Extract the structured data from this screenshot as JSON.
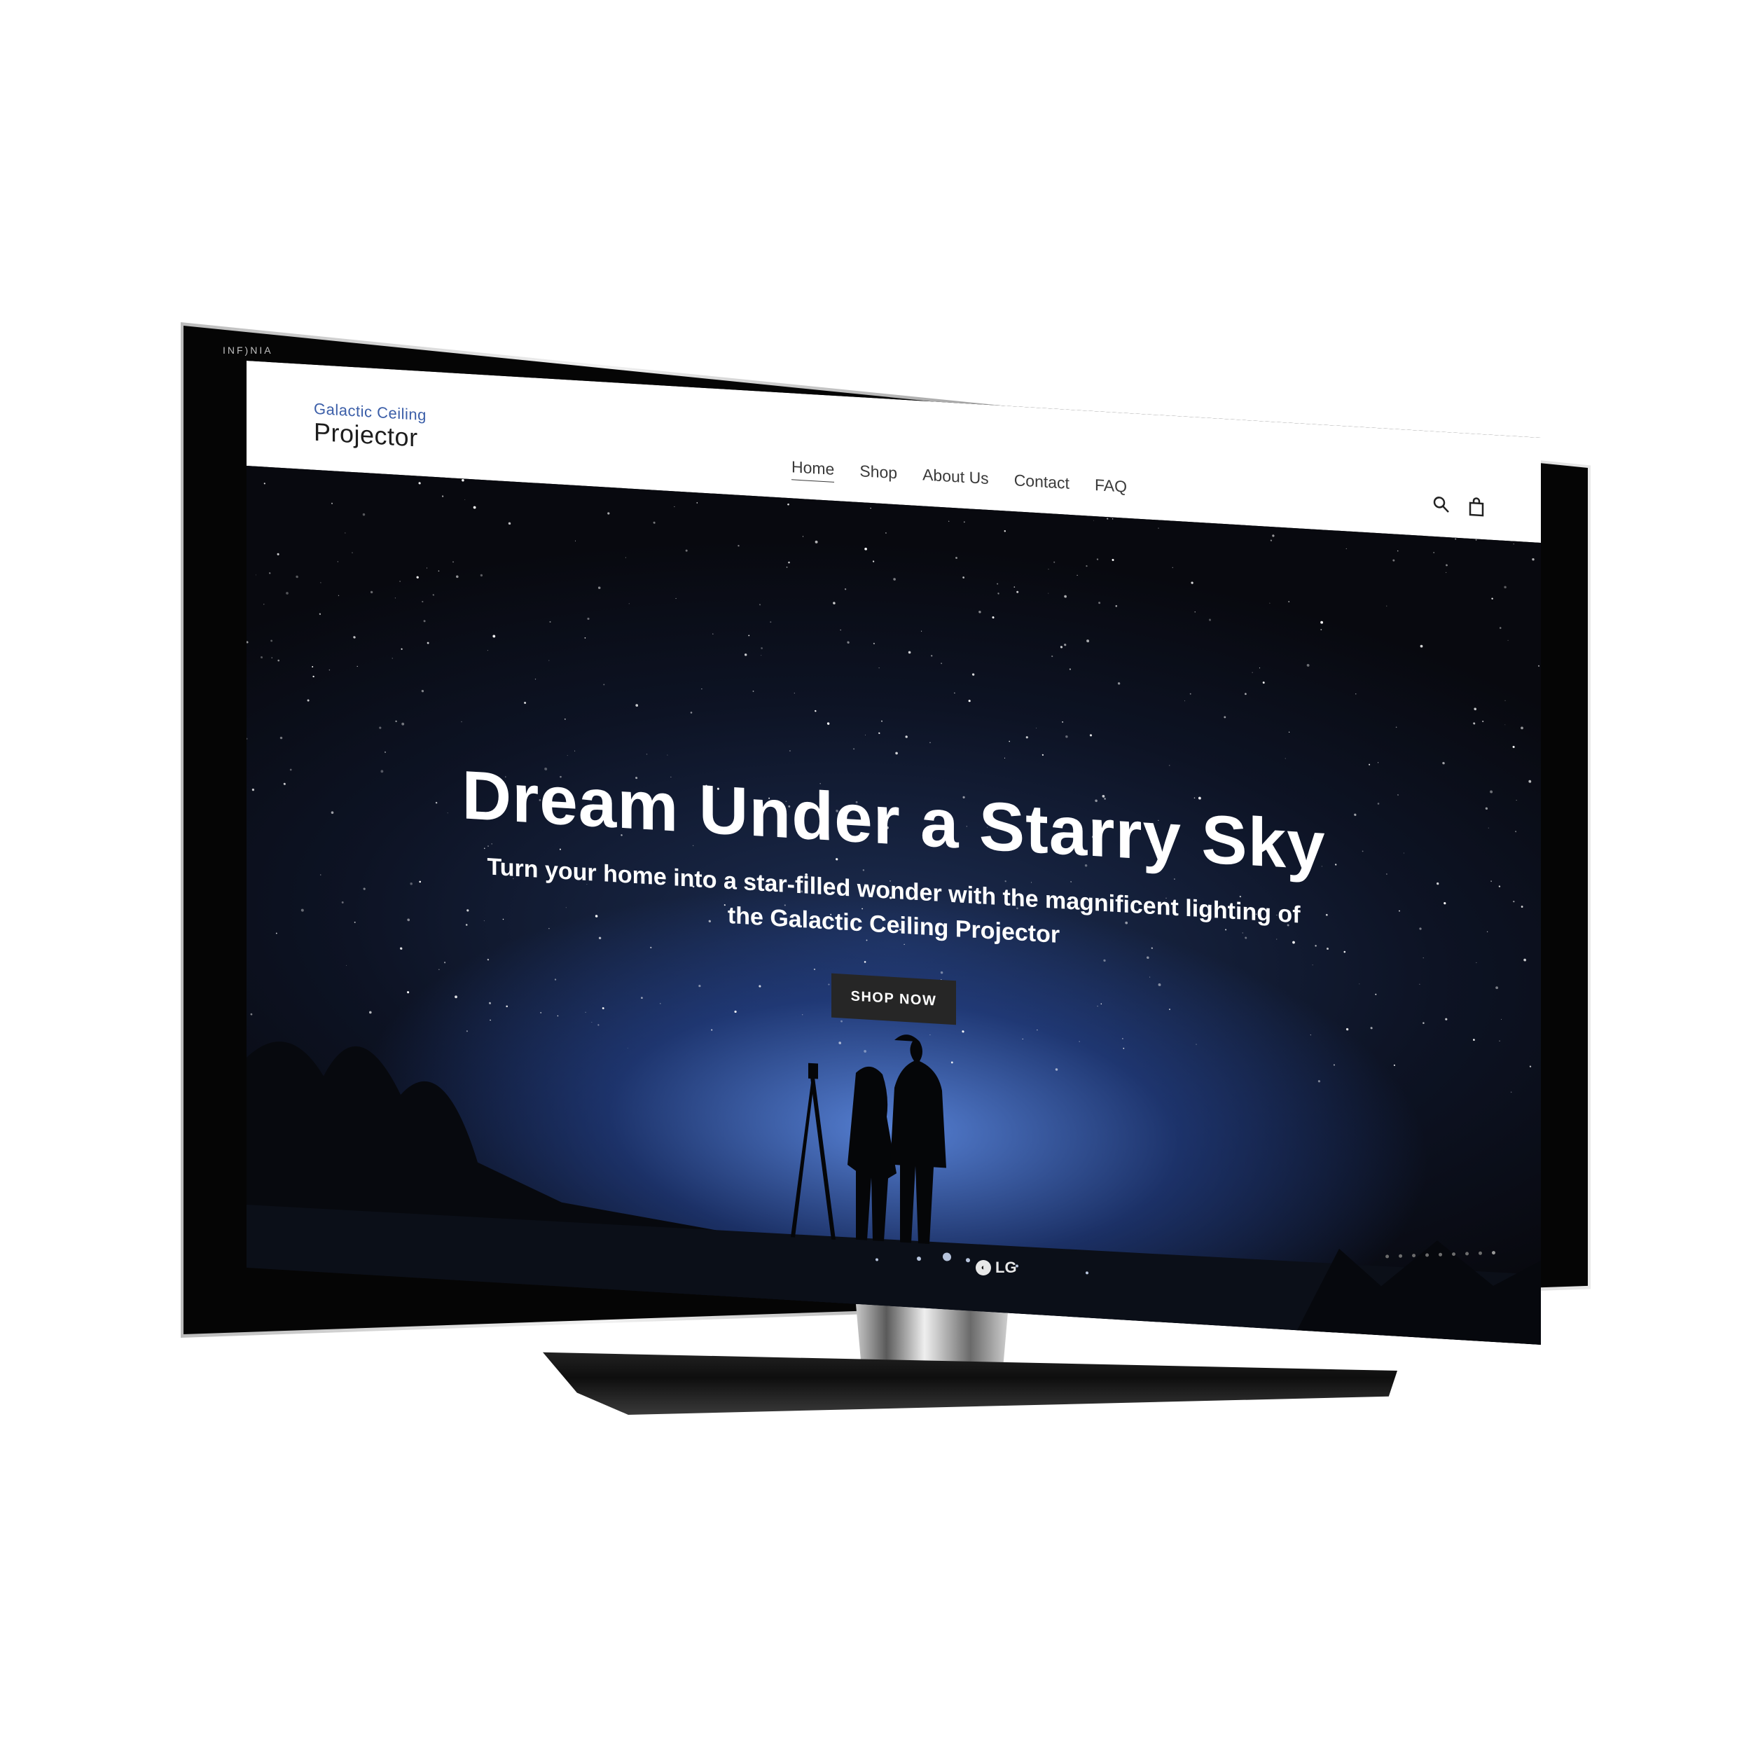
{
  "device": {
    "bezel_brand": "INF)NIA",
    "tv_logo": "LG"
  },
  "site": {
    "logo": {
      "line1": "Galactic Ceiling",
      "line2": "Projector"
    },
    "nav": [
      {
        "label": "Home",
        "active": true
      },
      {
        "label": "Shop"
      },
      {
        "label": "About Us"
      },
      {
        "label": "Contact"
      },
      {
        "label": "FAQ"
      }
    ],
    "icons": [
      "search-icon",
      "cart-icon"
    ]
  },
  "hero": {
    "title": "Dream Under a Starry Sky",
    "subtitle": "Turn your home into a star-filled wonder with the magnificent lighting of the Galactic Ceiling Projector",
    "cta": "SHOP NOW"
  },
  "colors": {
    "header_bg": "#ffffff",
    "nav_text": "#3a3a3a",
    "logo_accent": "#3b5ea8",
    "button_bg": "#262626",
    "sky_glow": "#5e8ce6"
  }
}
